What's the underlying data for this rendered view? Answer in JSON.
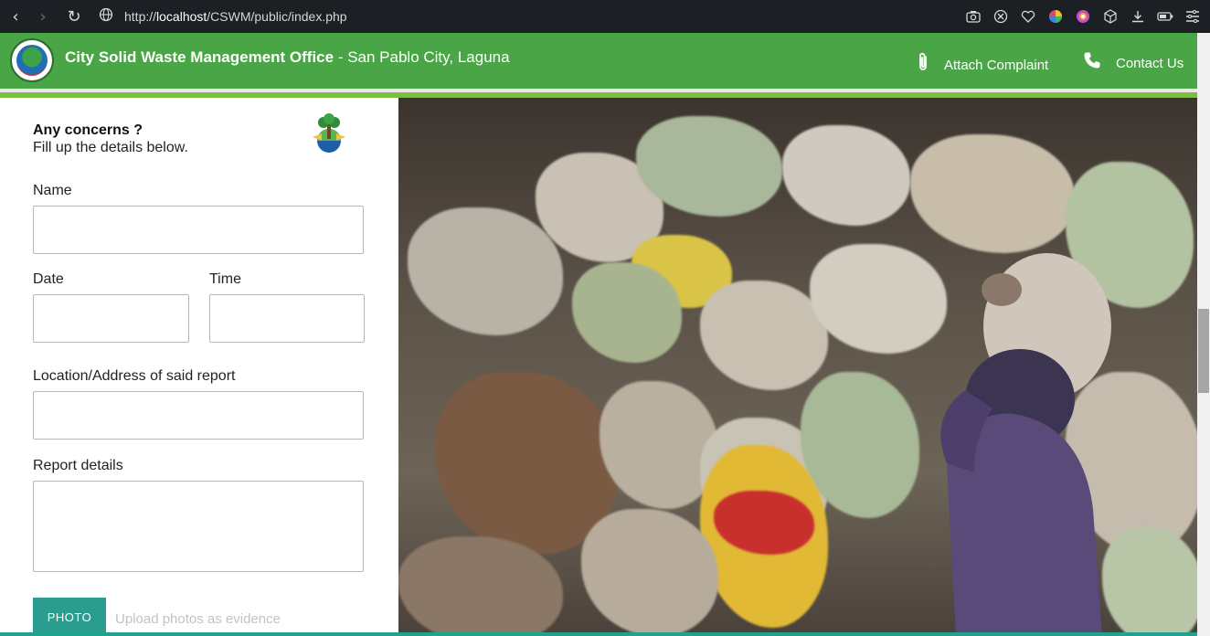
{
  "browser": {
    "url_prefix": "http://",
    "url_host": "localhost",
    "url_path": "/CSWM/public/index.php"
  },
  "header": {
    "title_bold": "City Solid Waste Management Office",
    "title_rest": " - San Pablo City, Laguna",
    "attach_label": "Attach Complaint",
    "contact_label": "Contact Us"
  },
  "form": {
    "heading": "Any concerns ?",
    "subheading": "Fill up the details below.",
    "name_label": "Name",
    "name_value": "",
    "date_label": "Date",
    "date_value": "",
    "time_label": "Time",
    "time_value": "",
    "location_label": "Location/Address of said report",
    "location_value": "",
    "details_label": "Report details",
    "details_value": "",
    "photo_button": "PHOTO",
    "photo_hint": "Upload photos as evidence"
  },
  "colors": {
    "header_green": "#4aa546",
    "accent_green": "#7cbf3f",
    "photo_button": "#2a9d8f"
  }
}
